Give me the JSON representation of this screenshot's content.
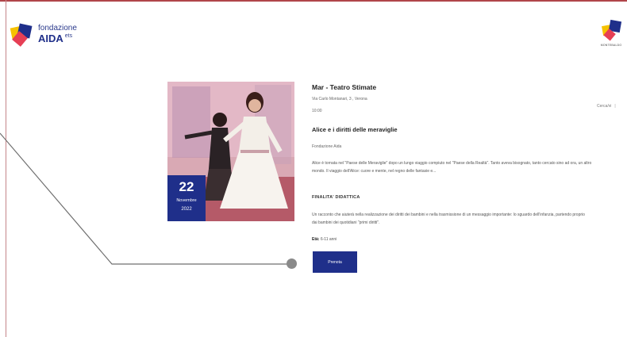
{
  "logo": {
    "line1": "fondazione",
    "line2": "AIDA",
    "suffix": "ets"
  },
  "badge": {
    "caption": "MONTEBALDO"
  },
  "side_control": {
    "label": "Cerca/vi",
    "separator": "|"
  },
  "event": {
    "venue": "Mar - Teatro Stimate",
    "address": "Via Carlo Montanari, 3 , Verona",
    "time": "10:00",
    "title": "Alice e i diritti delle meraviglie",
    "organizer": "Fondazione Aida",
    "description": "Alice è tornata nel \"Paese delle Meraviglie\" dopo un lungo viaggio compiuto nel \"Paese della Realtà\". Tanto aveva bisognato, tanto cercato sino ad ora, un altro mondo. Il viaggio dell'Alice: cuore e mente, nel regno delle fantasie e...",
    "date": {
      "day": "22",
      "month": "Novembre",
      "year": "2022"
    },
    "section_heading": "FINALITA' DIDATTICA",
    "section_body": "Un racconto che aiuterà nella realizzazione dei diritti dei bambini e nella trasmissione di un messaggio importante: lo sguardo dell'infanzia, partendo proprio dai bambini dei quotidiani \"primi diritti\".",
    "age_label": "Età:",
    "age_value": "6-11 anni",
    "button_label": "Prenota"
  },
  "colors": {
    "brand_blue": "#1f2f8a",
    "frame_red": "#b0454a",
    "pointer_gray": "#8a8a8a"
  }
}
